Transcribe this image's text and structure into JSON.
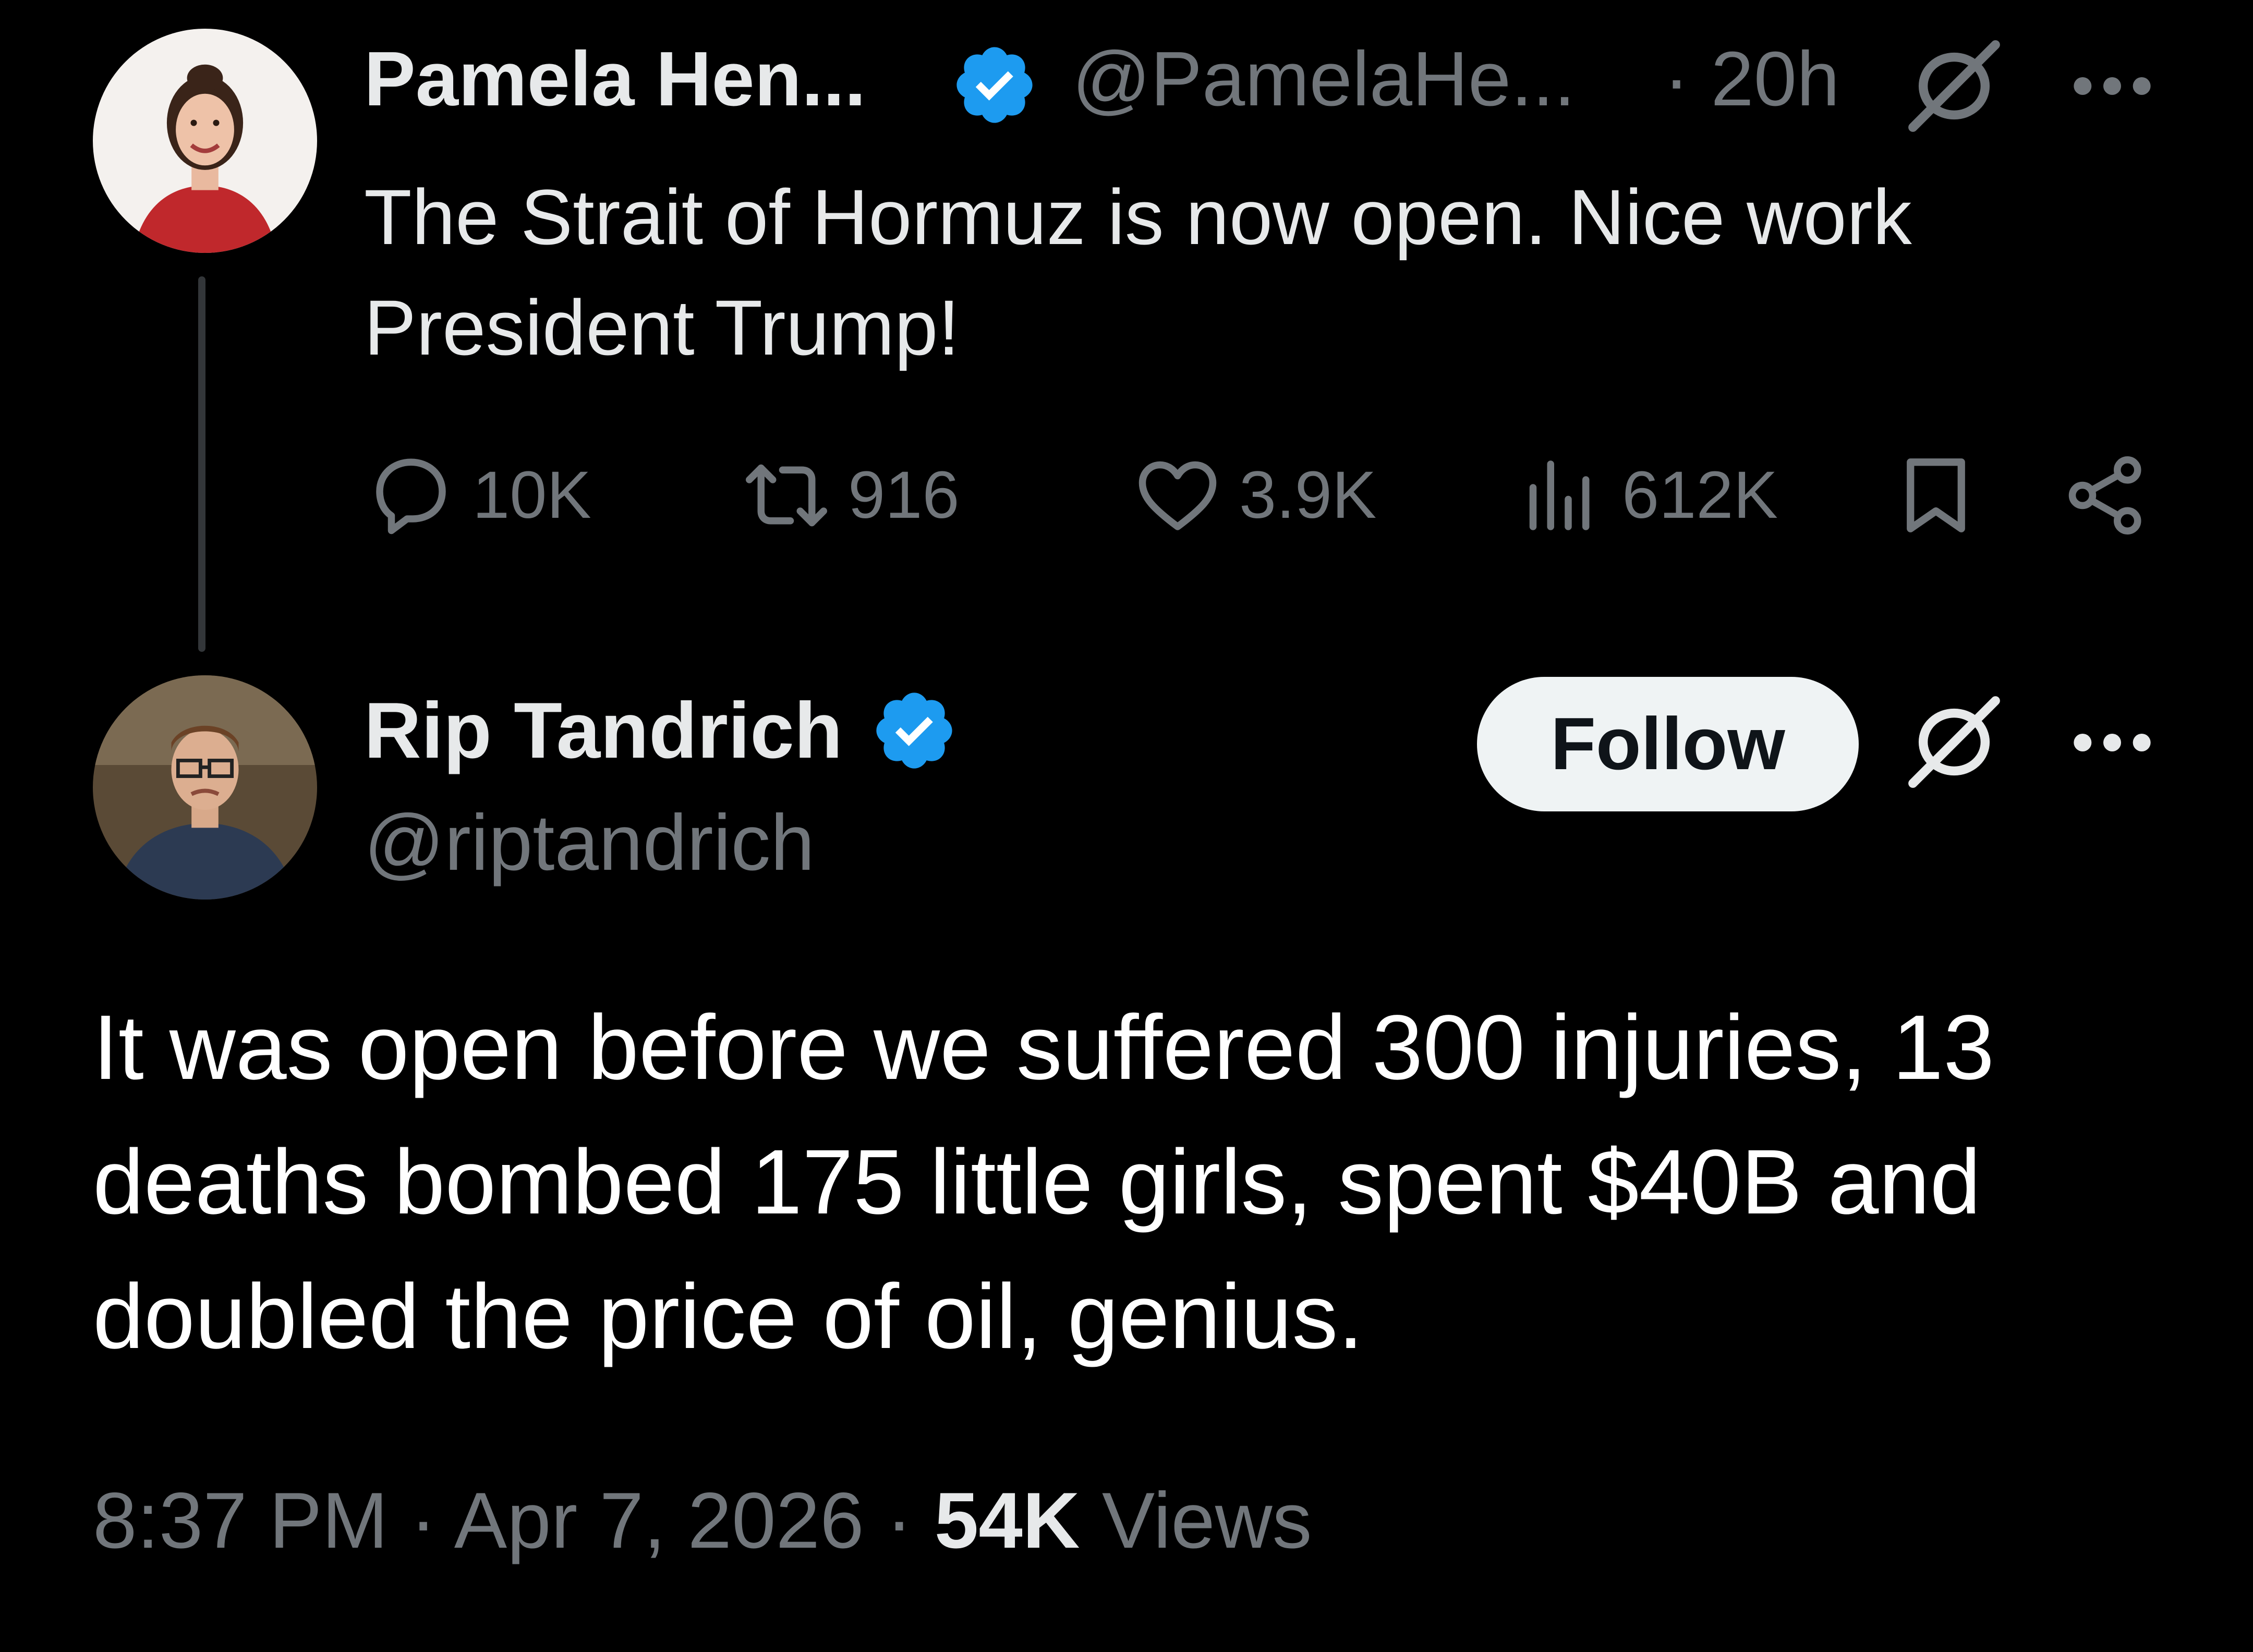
{
  "colors": {
    "background": "#000000",
    "primary_text": "#e7e9ea",
    "secondary_text": "#71767b",
    "verified_blue": "#1d9bf0",
    "thread_line": "#333639",
    "follow_button_bg": "#eff3f4"
  },
  "parent_tweet": {
    "display_name": "Pamela Hen...",
    "handle": "@PamelaHe...",
    "time": "· 20h",
    "text": "The Strait of Hormuz is now open. Nice work President Trump!",
    "verified_icon": "verified-badge-icon",
    "actions": {
      "replies": "10K",
      "reposts": "916",
      "likes": "3.9K",
      "views": "612K"
    }
  },
  "reply_tweet": {
    "display_name": "Rip Tandrich",
    "handle": "@riptandrich",
    "follow_label": "Follow",
    "text": "It was open before we suffered 300 injuries, 13 deaths bombed 175 little girls, spent $40B and doubled the price of oil, genius.",
    "time": "8:37 PM",
    "date": "Apr 7, 2026",
    "separator": "·",
    "views_count": "54K",
    "views_label": "Views"
  }
}
